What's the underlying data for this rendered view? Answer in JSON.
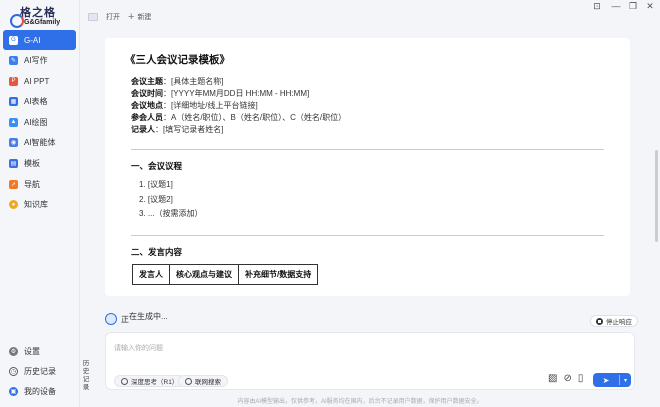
{
  "brand": {
    "title": "格之格",
    "subtitle": "G&Gfamily"
  },
  "sidebar": {
    "items": [
      {
        "label": "G-AI",
        "icon": "gai-icon",
        "color": "#2f6fe8",
        "active": true
      },
      {
        "label": "AI写作",
        "icon": "pen-icon",
        "color": "#3b7ff0"
      },
      {
        "label": "AI PPT",
        "icon": "ppt-icon",
        "color": "#e9553d"
      },
      {
        "label": "AI表格",
        "icon": "sheet-icon",
        "color": "#2f6fe8"
      },
      {
        "label": "AI绘图",
        "icon": "paint-icon",
        "color": "#3a8ef5"
      },
      {
        "label": "AI智能体",
        "icon": "agent-icon",
        "color": "#4a7cf0"
      },
      {
        "label": "模板",
        "icon": "template-icon",
        "color": "#3b6fe3"
      },
      {
        "label": "导航",
        "icon": "nav-icon",
        "color": "#f07a2a"
      },
      {
        "label": "知识库",
        "icon": "knowledge-icon",
        "color": "#f2a81d"
      }
    ],
    "bottom": [
      {
        "label": "设置",
        "icon": "gear-icon"
      },
      {
        "label": "历史记录",
        "icon": "history-icon"
      },
      {
        "label": "我的设备",
        "icon": "device-icon"
      }
    ]
  },
  "history_strip": "历史记录",
  "toolbar": {
    "open_label": "打开",
    "new_label": "新建"
  },
  "window_controls": {
    "pin": "⊡",
    "minimize": "—",
    "restore": "❐",
    "close": "✕"
  },
  "document": {
    "title": "《三人会议记录模板》",
    "meta": [
      {
        "key": "会议主题",
        "value": "：[具体主题名称]"
      },
      {
        "key": "会议时间",
        "value": "：[YYYY年MM月DD日 HH:MM - HH:MM]"
      },
      {
        "key": "会议地点",
        "value": "：[详细地址/线上平台链接]"
      },
      {
        "key": "参会人员",
        "value": "：A（姓名/职位）、B（姓名/职位）、C（姓名/职位）"
      },
      {
        "key": "记录人",
        "value": "：[填写记录者姓名]"
      }
    ],
    "section1_title": "一、会议议程",
    "agenda": [
      "1. [议题1]",
      "2. [议题2]",
      "3. ...（按需添加）"
    ],
    "section2_title": "二、发言内容",
    "table_headers": [
      "发言人",
      "核心观点与建议",
      "补充细节/数据支持"
    ]
  },
  "generating": {
    "text_a": "正",
    "text_b": "在生成中..."
  },
  "stop_button": "停止响应",
  "input": {
    "placeholder": "请输入你的问题",
    "chip_think": "深度思考（R1）",
    "chip_web": "联网搜索",
    "send_icon": "➤",
    "dropdown_icon": "▾"
  },
  "footer": "内容由AI模型输出，仅供参考，AI服务均在国内，后台不记录用户数据，保护用户数据安全。"
}
